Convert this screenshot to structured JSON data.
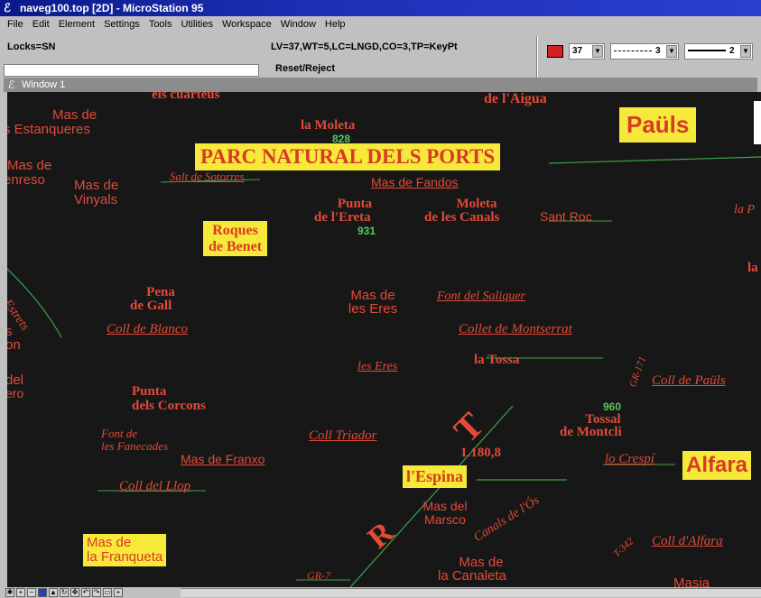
{
  "window": {
    "title": "naveg100.top [2D] - MicroStation 95"
  },
  "menu": [
    "File",
    "Edit",
    "Element",
    "Settings",
    "Tools",
    "Utilities",
    "Workspace",
    "Window",
    "Help"
  ],
  "status": {
    "locks": "Locks=SN",
    "settings": "LV=37,WT=5,LC=LNGD,CO=3,TP=KeyPt",
    "prompt": "Reset/Reject",
    "color_value": "37",
    "style_value": "3",
    "weight_value": "2",
    "active_color": "#d42020"
  },
  "view_window": {
    "title": "Window 1"
  },
  "map": {
    "background": "#171717",
    "label_color": "#e34a37",
    "number_color": "#58c75a",
    "box_color": "#f7e93a",
    "labels": {
      "els_cuarteus": "els cuarteus",
      "de_laigua": "de l'Aigua",
      "mas_de_estanqueres_1": "Mas de",
      "mas_de_estanqueres_2": "s Estanqueres",
      "la_moleta": "la Moleta",
      "mas_de_enreso_1": "Mas de",
      "mas_de_enreso_2": "enreso",
      "salt_de_sotorres": "Salt de Sotorres",
      "mas_de_vinyals_1": "Mas de",
      "mas_de_vinyals_2": "Vinyals",
      "mas_de_fandos": "Mas de Fandos",
      "punta_ereta_1": "Punta",
      "punta_ereta_2": "de l'Ereta",
      "moleta_canals_1": "Moleta",
      "moleta_canals_2": "de les Canals",
      "sant_roc": "Sant Roc",
      "la_p": "la P",
      "la_right": "la",
      "estrets": "Estrets",
      "on_left": "on",
      "s_left": "s",
      "pena_gall_1": "Pena",
      "pena_gall_2": "de Gall",
      "mas_eres_1": "Mas de",
      "mas_eres_2": "les Eres",
      "font_saliquer": "Font del Saliquer",
      "coll_blanco": "Coll de Blanco",
      "collet_montserrat": "Collet de Montserrat",
      "les_eres": "les Eres",
      "la_tossa": "la Tossa",
      "gr_171": "GR-171",
      "coll_pauls": "Coll de Paüls",
      "del_left": "del",
      "ero_left": "ero",
      "punta_corcons_1": "Punta",
      "punta_corcons_2": "dels Corcons",
      "tossal_montcli_1": "Tossal",
      "tossal_montcli_2": "de Montcli",
      "font_fanecades_1": "Font de",
      "font_fanecades_2": "les Fanecades",
      "coll_triador": "Coll Triador",
      "letter_t": "T",
      "spot_1180": "1.180,8",
      "mas_franxo": "Mas de Franxo",
      "lo_crespi": "lo Crespí",
      "coll_llop": "Coll del Llop",
      "mas_marsco_1": "Mas del",
      "mas_marsco_2": "Marsco",
      "canals_os": "Canals de l'Ós",
      "letter_r": "R",
      "t_342": "T-342",
      "coll_alfara": "Coll d'Alfara",
      "mas_canaleta_1": "Mas de",
      "mas_canaleta_2": "la Canaleta",
      "gr_7": "GR-7",
      "masia": "Masia"
    },
    "numbers": {
      "moleta": "828",
      "ereta": "931",
      "tossal": "960"
    },
    "boxed": {
      "pauls": "Paüls",
      "parc": "PARC NATURAL DELS PORTS",
      "roques_1": "Roques",
      "roques_2": "de Benet",
      "espina": "l'Espina",
      "alfara": "Alfara",
      "franqueta_1": "Mas de",
      "franqueta_2": "la Franqueta"
    }
  }
}
